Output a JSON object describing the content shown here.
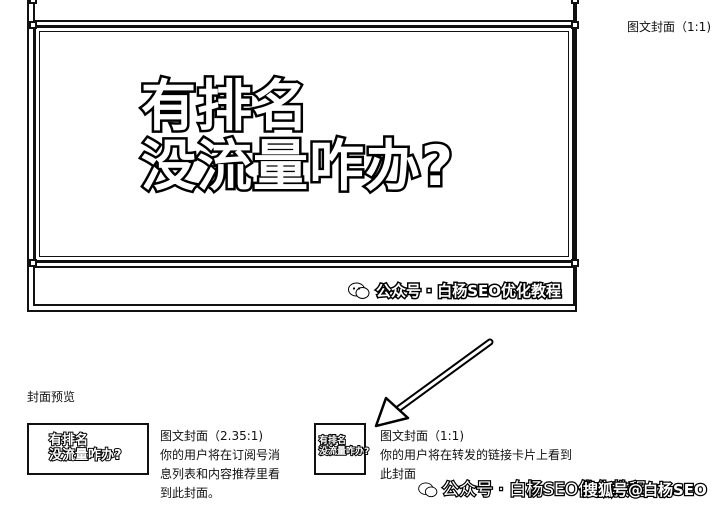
{
  "editor": {
    "headline_line1": "有排名",
    "headline_line2": "没流量咋办?",
    "brand_text": "公众号 · 白杨SEO优化教程",
    "ratio_label": "图文封面（1:1)"
  },
  "preview": {
    "section_title": "封面预览",
    "thumb_line1": "有排名",
    "thumb_line2": "没流量咋办?",
    "options": [
      {
        "title": "图文封面（2.35:1)",
        "description": "你的用户将在订阅号消息列表和内容推荐里看到此封面。"
      },
      {
        "title": "图文封面（1:1)",
        "description": "你的用户将在转发的链接卡片上看到此封面"
      }
    ]
  },
  "watermarks": {
    "left": "公众号 · 白杨SEO优化教程",
    "right": "搜狐号@白杨SEO"
  }
}
